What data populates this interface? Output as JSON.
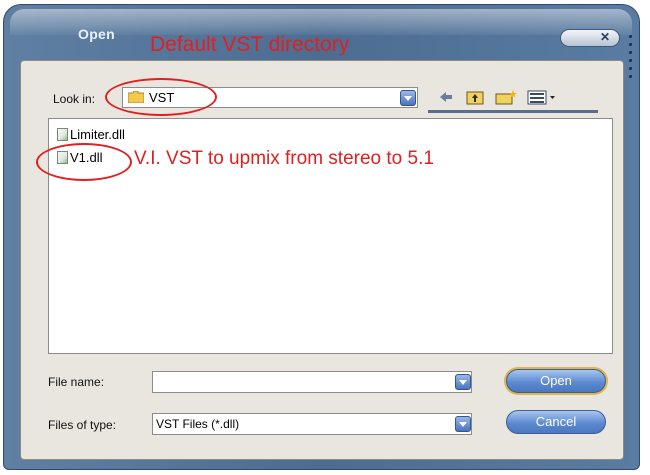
{
  "window": {
    "title": "Open"
  },
  "annotations": {
    "directory_note": "Default VST directory",
    "file_note": "V.I. VST to upmix from stereo to 5.1"
  },
  "lookin": {
    "label": "Look in:",
    "value": "VST"
  },
  "toolbar": {
    "icons": [
      "back-arrow-icon",
      "up-folder-icon",
      "new-folder-icon",
      "view-menu-icon"
    ]
  },
  "files": [
    {
      "name": "Limiter.dll"
    },
    {
      "name": "V1.dll"
    }
  ],
  "filename": {
    "label": "File name:",
    "value": ""
  },
  "filetype": {
    "label": "Files of type:",
    "value": "VST Files (*.dll)"
  },
  "buttons": {
    "open": "Open",
    "cancel": "Cancel"
  },
  "colors": {
    "annotation": "#e02020",
    "frame": "#4c6c92",
    "button": "#5d8ad0"
  }
}
